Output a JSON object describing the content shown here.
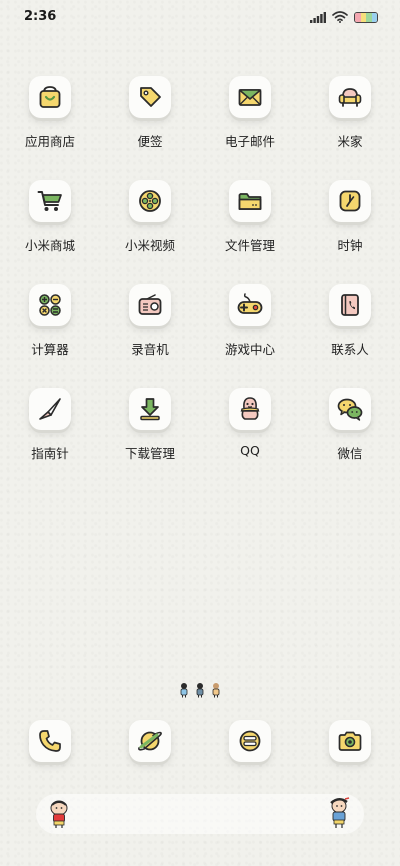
{
  "status_bar": {
    "time": "2:36"
  },
  "apps": [
    [
      {
        "label": "应用商店",
        "icon": "shopping-bag-icon"
      },
      {
        "label": "便签",
        "icon": "tag-icon"
      },
      {
        "label": "电子邮件",
        "icon": "envelope-icon"
      },
      {
        "label": "米家",
        "icon": "sofa-icon"
      }
    ],
    [
      {
        "label": "小米商城",
        "icon": "shopping-cart-icon"
      },
      {
        "label": "小米视频",
        "icon": "film-reel-icon"
      },
      {
        "label": "文件管理",
        "icon": "folder-icon"
      },
      {
        "label": "时钟",
        "icon": "clock-icon"
      }
    ],
    [
      {
        "label": "计算器",
        "icon": "calculator-icon"
      },
      {
        "label": "录音机",
        "icon": "radio-icon"
      },
      {
        "label": "游戏中心",
        "icon": "gamepad-icon"
      },
      {
        "label": "联系人",
        "icon": "contact-book-icon"
      }
    ],
    [
      {
        "label": "指南针",
        "icon": "compass-icon"
      },
      {
        "label": "下载管理",
        "icon": "download-arrow-icon"
      },
      {
        "label": "QQ",
        "icon": "qq-penguin-icon"
      },
      {
        "label": "微信",
        "icon": "wechat-bubbles-icon"
      }
    ]
  ],
  "dock": [
    {
      "icon": "phone-icon"
    },
    {
      "icon": "browser-planet-icon"
    },
    {
      "icon": "message-icon"
    },
    {
      "icon": "camera-icon"
    }
  ],
  "colors": {
    "background": "#f1f1ec",
    "icon_yellow": "#f5d76e",
    "icon_green": "#7bb661",
    "icon_outline": "#2b2b2b",
    "icon_pink": "#f4c9c0"
  }
}
